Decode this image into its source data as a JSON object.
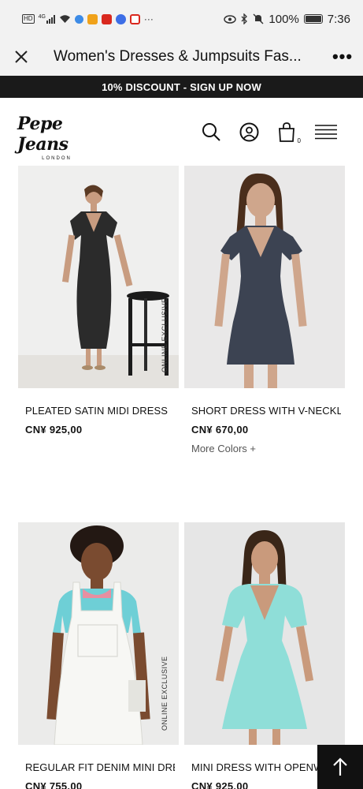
{
  "status_bar": {
    "network": "4G",
    "hd_badge": "HD",
    "battery": "100%",
    "time": "7:36",
    "more_dots": "···"
  },
  "browser": {
    "title": "Women's Dresses & Jumpsuits Fas...",
    "more_label": "•••"
  },
  "promo": {
    "text": "10% DISCOUNT - SIGN UP NOW"
  },
  "brand": {
    "name": "Pepe Jeans",
    "tagline": "LONDON"
  },
  "header": {
    "cart_count": "0"
  },
  "products": [
    {
      "name": "PLEATED SATIN MIDI DRESS",
      "price": "CN¥ 925,00",
      "badge": "ONLINE EXCLUSIVE"
    },
    {
      "name": "SHORT DRESS WITH V-NECKLI...",
      "price": "CN¥ 670,00",
      "more_colors": "More Colors  +"
    },
    {
      "name": "REGULAR FIT DENIM MINI DRE...",
      "price": "CN¥ 755,00",
      "badge": "ONLINE EXCLUSIVE"
    },
    {
      "name": "MINI DRESS WITH OPENWO",
      "price": "CN¥ 925,00"
    }
  ],
  "colors": {
    "promo_bg": "#1a1a1a",
    "status_bg": "#f2f2f2",
    "img_bg": "#ededec"
  }
}
